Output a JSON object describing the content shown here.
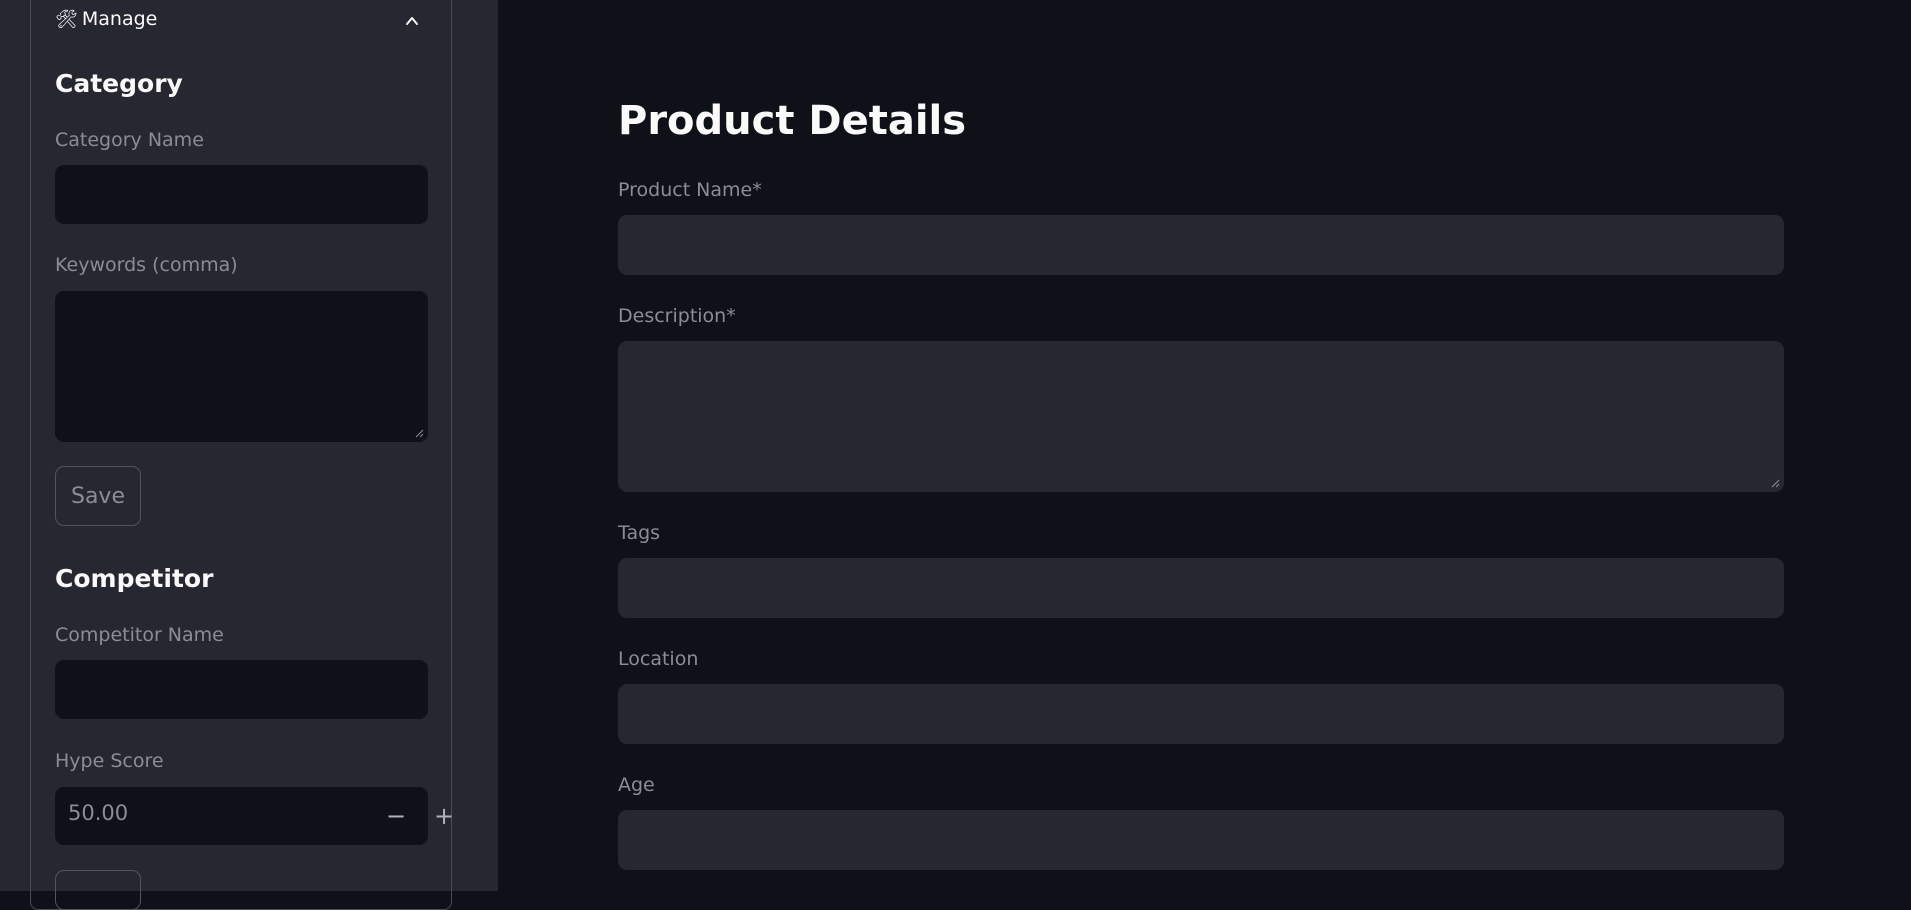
{
  "sidebar": {
    "expander": {
      "icon": "hammer-wrench-icon",
      "label": "Manage"
    },
    "category": {
      "title": "Category",
      "name_label": "Category Name",
      "name_value": "",
      "keywords_label": "Keywords (comma)",
      "keywords_value": "",
      "save_label": "Save"
    },
    "competitor": {
      "title": "Competitor",
      "name_label": "Competitor Name",
      "name_value": "",
      "hype_label": "Hype Score",
      "hype_value": "50.00"
    }
  },
  "main": {
    "title": "Product Details",
    "fields": {
      "product_name": {
        "label": "Product Name*",
        "value": ""
      },
      "description": {
        "label": "Description*",
        "value": ""
      },
      "tags": {
        "label": "Tags",
        "value": ""
      },
      "location": {
        "label": "Location",
        "value": ""
      },
      "age": {
        "label": "Age",
        "value": ""
      }
    }
  }
}
